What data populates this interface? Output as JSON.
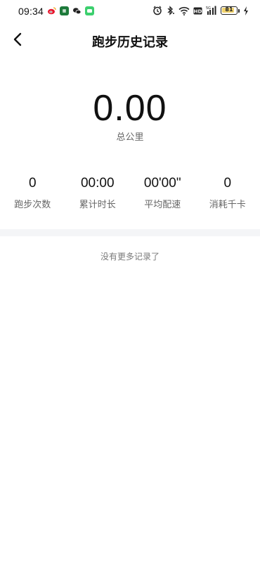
{
  "status_bar": {
    "time": "09:34",
    "battery": 81
  },
  "header": {
    "title": "跑步历史记录"
  },
  "summary": {
    "total_value": "0.00",
    "total_label": "总公里"
  },
  "stats": [
    {
      "value": "0",
      "label": "跑步次数"
    },
    {
      "value": "00:00",
      "label": "累计时长"
    },
    {
      "value": "00'00\"",
      "label": "平均配速"
    },
    {
      "value": "0",
      "label": "消耗千卡"
    }
  ],
  "list": {
    "end_text": "没有更多记录了"
  }
}
